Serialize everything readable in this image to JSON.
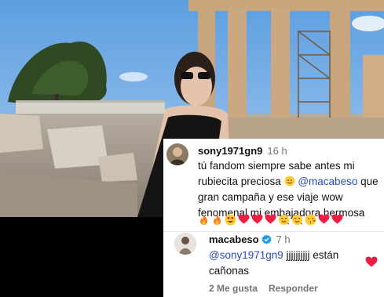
{
  "colors": {
    "mention": "#2c4bb8",
    "heart": "#ed1d44",
    "verified": "#1d9bf0",
    "muted": "#737373"
  },
  "comments": [
    {
      "username": "sony1971gn9",
      "time": "16 h",
      "text_1": "tú fandom siempre sabe antes mi rubiecita preciosa",
      "emoji_inline": "smiling-face-icon",
      "mention": "@macabeso",
      "text_2": "que gran campaña y ese viaje wow fenomenal mi embajadora hermosa",
      "reactions": [
        "fire-icon",
        "fire-icon",
        "heart-eyes-icon",
        "red-heart-icon",
        "red-heart-icon",
        "red-heart-icon",
        "hearts-face-icon",
        "hearts-face-icon",
        "kiss-heart-icon",
        "red-heart-icon",
        "red-heart-icon"
      ]
    },
    {
      "username": "macabeso",
      "verified": true,
      "time": "7 h",
      "mention": "@sony1971gn9",
      "text": "jjjjjjjjjj están cañonas",
      "likes_label": "2 Me gusta",
      "reply_label": "Responder",
      "like_icon": "red-heart-icon"
    }
  ]
}
